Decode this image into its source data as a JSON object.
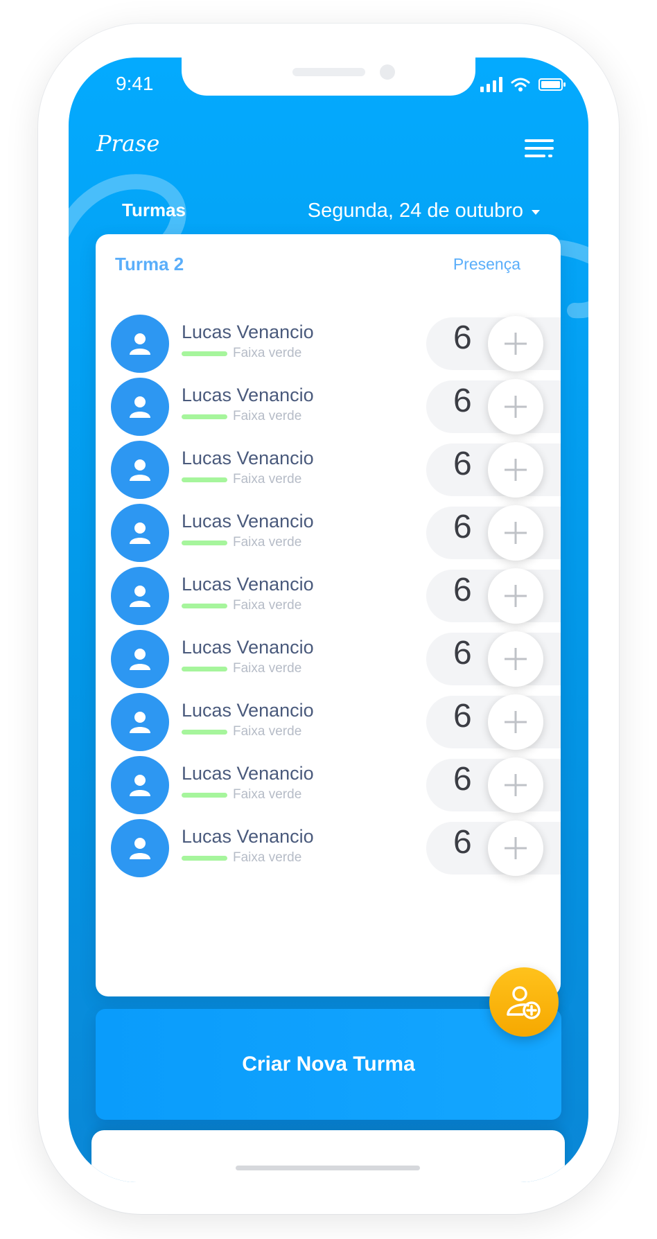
{
  "status_bar": {
    "time": "9:41"
  },
  "header": {
    "brand": "Prase",
    "watermark": "Prase"
  },
  "nav": {
    "tab_label": "Turmas",
    "date_label": "Segunda, 24 de outubro"
  },
  "card": {
    "title": "Turma 2",
    "column_label": "Presença",
    "students": [
      {
        "name": "Lucas Venancio",
        "belt": "Faixa verde",
        "count": "6"
      },
      {
        "name": "Lucas Venancio",
        "belt": "Faixa verde",
        "count": "6"
      },
      {
        "name": "Lucas Venancio",
        "belt": "Faixa verde",
        "count": "6"
      },
      {
        "name": "Lucas Venancio",
        "belt": "Faixa verde",
        "count": "6"
      },
      {
        "name": "Lucas Venancio",
        "belt": "Faixa verde",
        "count": "6"
      },
      {
        "name": "Lucas Venancio",
        "belt": "Faixa verde",
        "count": "6"
      },
      {
        "name": "Lucas Venancio",
        "belt": "Faixa verde",
        "count": "6"
      },
      {
        "name": "Lucas Venancio",
        "belt": "Faixa verde",
        "count": "6"
      },
      {
        "name": "Lucas Venancio",
        "belt": "Faixa verde",
        "count": "6"
      }
    ]
  },
  "actions": {
    "create_label": "Criar Nova Turma",
    "fab_icon": "add-user-icon"
  },
  "icons": {
    "menu": "menu-icon",
    "avatar": "user-icon",
    "plus": "plus-icon",
    "caret": "caret-down-icon"
  },
  "colors": {
    "accent": "#04aafe",
    "belt": "#a6f59c",
    "fab": "#ffb80b"
  }
}
